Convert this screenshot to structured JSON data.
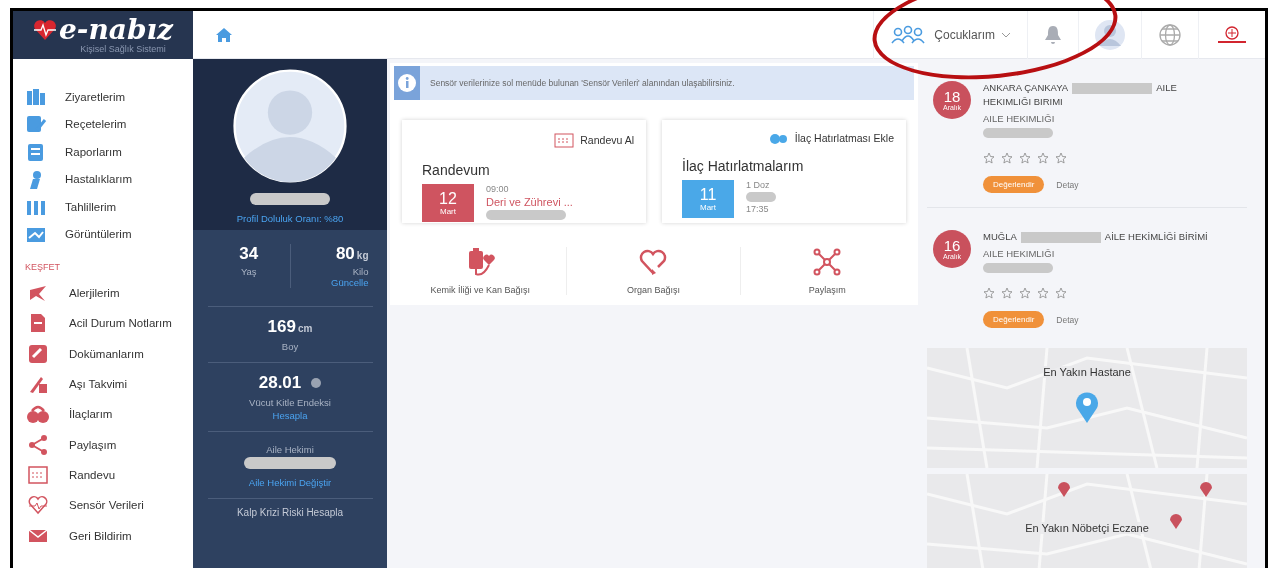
{
  "logo": {
    "name": "e-nabız",
    "subtitle": "Kişisel Sağlık Sistemi"
  },
  "topbar": {
    "children_menu": "Çocuklarım"
  },
  "sidebar": {
    "items": [
      "Ziyaretlerim",
      "Reçetelerim",
      "Raporlarım",
      "Hastalıklarım",
      "Tahlillerim",
      "Görüntülerim"
    ],
    "section": "KEŞFET",
    "explore_items": [
      "Alerjilerim",
      "Acil Durum Notlarım",
      "Dokümanlarım",
      "Aşı Takvimi",
      "İlaçlarım",
      "Paylaşım",
      "Randevu",
      "Sensör Verileri",
      "Geri Bildirim"
    ]
  },
  "profile": {
    "completion": "Profil Doluluk Oranı: %80",
    "age": {
      "value": "34",
      "label": "Yaş"
    },
    "weight": {
      "value": "80",
      "unit": "kg",
      "label": "Kilo",
      "link": "Güncelle"
    },
    "height": {
      "value": "169",
      "unit": "cm",
      "label": "Boy"
    },
    "bmi": {
      "value": "28.01",
      "label": "Vücut Kitle Endeksi",
      "link": "Hesapla"
    },
    "doctor": {
      "label": "Aile Hekimi",
      "link": "Aile Hekimi Değiştir"
    },
    "heart_risk": "Kalp Krizi Riski Hesapla"
  },
  "info_banner": "Sensör verilerinize sol menüde bulunan 'Sensör Verileri' alanından ulaşabilirsiniz.",
  "cards": [
    {
      "kind": "appointment",
      "action": "Randevu Al",
      "title": "Randevum",
      "day": "12",
      "month": "Mart",
      "lines": [
        {
          "kind": "time",
          "text": "09:00"
        },
        {
          "kind": "link",
          "text": "Deri ve Zührevi ..."
        },
        {
          "kind": "redacted"
        }
      ]
    },
    {
      "kind": "medication",
      "action": "İlaç Hatırlatması Ekle",
      "title": "İlaç Hatırlatmalarım",
      "day": "11",
      "month": "Mart",
      "lines": [
        {
          "kind": "time",
          "text": "1 Doz"
        },
        {
          "kind": "redacted"
        },
        {
          "kind": "time",
          "text": "17:35"
        }
      ]
    }
  ],
  "shortcuts": [
    "Kemik İliği ve Kan Bağışı",
    "Organ Bağışı",
    "Paylaşım"
  ],
  "visits": [
    {
      "day": "18",
      "month": "Aralık",
      "title_start": "ANKARA ÇANKAYA",
      "title_end": "AILE HEKIMLIĞI BIRIMI",
      "type": "AILE HEKIMLIĞI",
      "stars": 0,
      "rate": "Değerlendir",
      "detail": "Detay"
    },
    {
      "day": "16",
      "month": "Aralık",
      "title_start": "MUĞLA",
      "title_end": "AİLE HEKİMLİĞİ BİRİMİ",
      "type": "AILE HEKIMLIĞI",
      "stars": 0,
      "rate": "Değerlendir",
      "detail": "Detay"
    }
  ],
  "maps": [
    {
      "kind": "hospital",
      "title": "En Yakın Hastane"
    },
    {
      "kind": "pharmacy",
      "title": "En Yakın Nöbetçi Eczane"
    }
  ]
}
